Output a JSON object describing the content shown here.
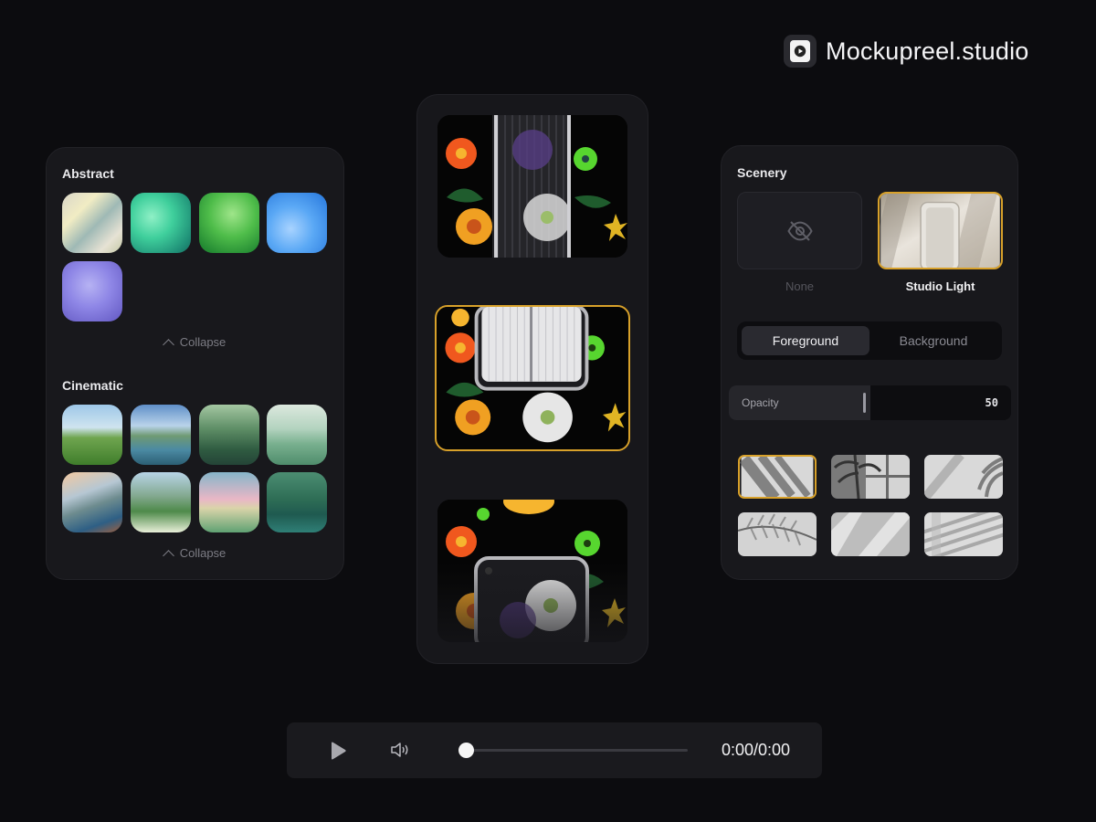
{
  "brand": {
    "name": "Mockupreel.studio",
    "icon": "play-logo-icon"
  },
  "left_panel": {
    "sections": [
      {
        "title": "Abstract",
        "collapse_label": "Collapse",
        "thumbs": [
          "abstract-silk",
          "abstract-mint",
          "abstract-green",
          "abstract-blue",
          "abstract-lavender"
        ]
      },
      {
        "title": "Cinematic",
        "collapse_label": "Collapse",
        "thumbs": [
          "cinematic-hills",
          "cinematic-lake",
          "cinematic-forest",
          "cinematic-dunes",
          "cinematic-island",
          "cinematic-valley",
          "cinematic-sunset",
          "cinematic-woods"
        ]
      }
    ]
  },
  "preview": {
    "selected_index": 1,
    "frames": 3
  },
  "right_panel": {
    "scenery_title": "Scenery",
    "options": [
      {
        "label": "None",
        "icon": "eye-off-icon"
      },
      {
        "label": "Studio Light"
      }
    ],
    "tabs": [
      {
        "label": "Foreground",
        "active": true
      },
      {
        "label": "Background",
        "active": false
      }
    ],
    "opacity": {
      "label": "Opacity",
      "value": "50",
      "fraction": 0.5
    },
    "shadows": [
      "shadow-blinds",
      "shadow-window-palm",
      "shadow-palm-corner",
      "shadow-fern",
      "shadow-diagonal-beams",
      "shadow-stripes"
    ],
    "selected_shadow": 0
  },
  "player": {
    "time": "0:00/0:00",
    "progress": 0,
    "play_icon": "play-icon",
    "volume_icon": "volume-icon"
  },
  "colors": {
    "accent": "#d8a12a",
    "background": "#0c0c0f",
    "panel": "#18181c"
  }
}
